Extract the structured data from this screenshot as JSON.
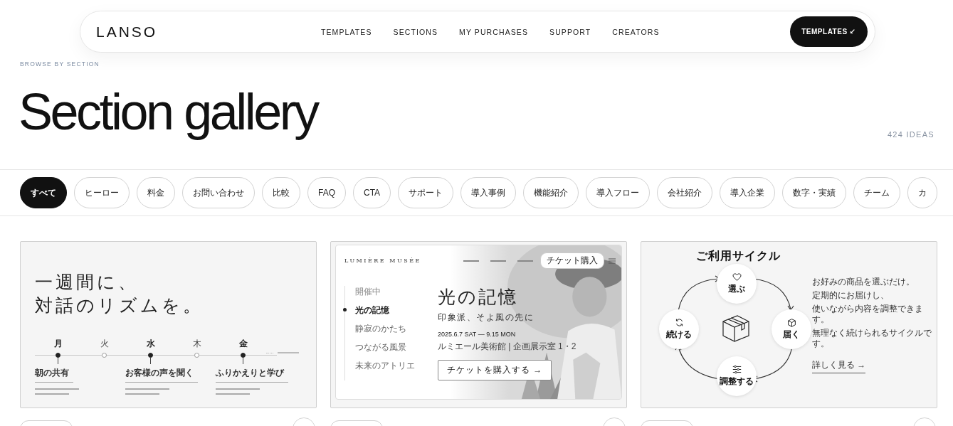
{
  "nav": {
    "logo": "LANSO",
    "links": [
      "TEMPLATES",
      "SECTIONS",
      "MY PURCHASES",
      "SUPPORT",
      "CREATORS"
    ],
    "cta": "TEMPLATES ↙"
  },
  "eyebrow": "BROWSE BY SECTION",
  "title": "Section gallery",
  "count": "424 IDEAS",
  "filters": [
    {
      "label": "すべて",
      "selected": true
    },
    {
      "label": "ヒーロー",
      "selected": false
    },
    {
      "label": "料金",
      "selected": false
    },
    {
      "label": "お問い合わせ",
      "selected": false
    },
    {
      "label": "比較",
      "selected": false
    },
    {
      "label": "FAQ",
      "selected": false
    },
    {
      "label": "CTA",
      "selected": false
    },
    {
      "label": "サポート",
      "selected": false
    },
    {
      "label": "導入事例",
      "selected": false
    },
    {
      "label": "機能紹介",
      "selected": false
    },
    {
      "label": "導入フロー",
      "selected": false
    },
    {
      "label": "会社紹介",
      "selected": false
    },
    {
      "label": "導入企業",
      "selected": false
    },
    {
      "label": "数字・実績",
      "selected": false
    },
    {
      "label": "チーム",
      "selected": false
    },
    {
      "label": "カ",
      "selected": false
    }
  ],
  "cards": [
    {
      "kind": "timeline",
      "headline": [
        "一週間に、",
        "対話のリズムを。"
      ],
      "days": [
        {
          "label": "月",
          "major": true
        },
        {
          "label": "火",
          "major": false
        },
        {
          "label": "水",
          "major": true
        },
        {
          "label": "木",
          "major": false
        },
        {
          "label": "金",
          "major": true
        }
      ],
      "items": [
        {
          "title": "朝の共有"
        },
        {
          "title": "お客様の声を聞く"
        },
        {
          "title": "ふりかえりと学び"
        }
      ]
    },
    {
      "kind": "museum",
      "logo": "LUMIÈRE MUSÉE",
      "ticket": "チケット購入",
      "status": "開催中",
      "menu": [
        {
          "label": "光の記憶",
          "selected": true
        },
        {
          "label": "静寂のかたち",
          "selected": false
        },
        {
          "label": "つながる風景",
          "selected": false
        },
        {
          "label": "未来のアトリエ",
          "selected": false
        }
      ],
      "title": "光の記憶",
      "subtitle": "印象派、そよ風の先に",
      "date": "2025.6.7 SAT — 9.15 MON",
      "venue": "ルミエール美術館 | 企画展示室 1・2",
      "button": "チケットを購入する →"
    },
    {
      "kind": "cycle",
      "title": "ご利用サイクル",
      "steps": [
        {
          "label": "選ぶ"
        },
        {
          "label": "届く"
        },
        {
          "label": "調整する"
        },
        {
          "label": "続ける"
        }
      ],
      "lines": [
        "お好みの商品を選ぶだけ。",
        "定期的にお届けし、",
        "使いながら内容を調整できます。",
        "無理なく続けられるサイクルです。"
      ],
      "link": "詳しく見る →"
    }
  ]
}
